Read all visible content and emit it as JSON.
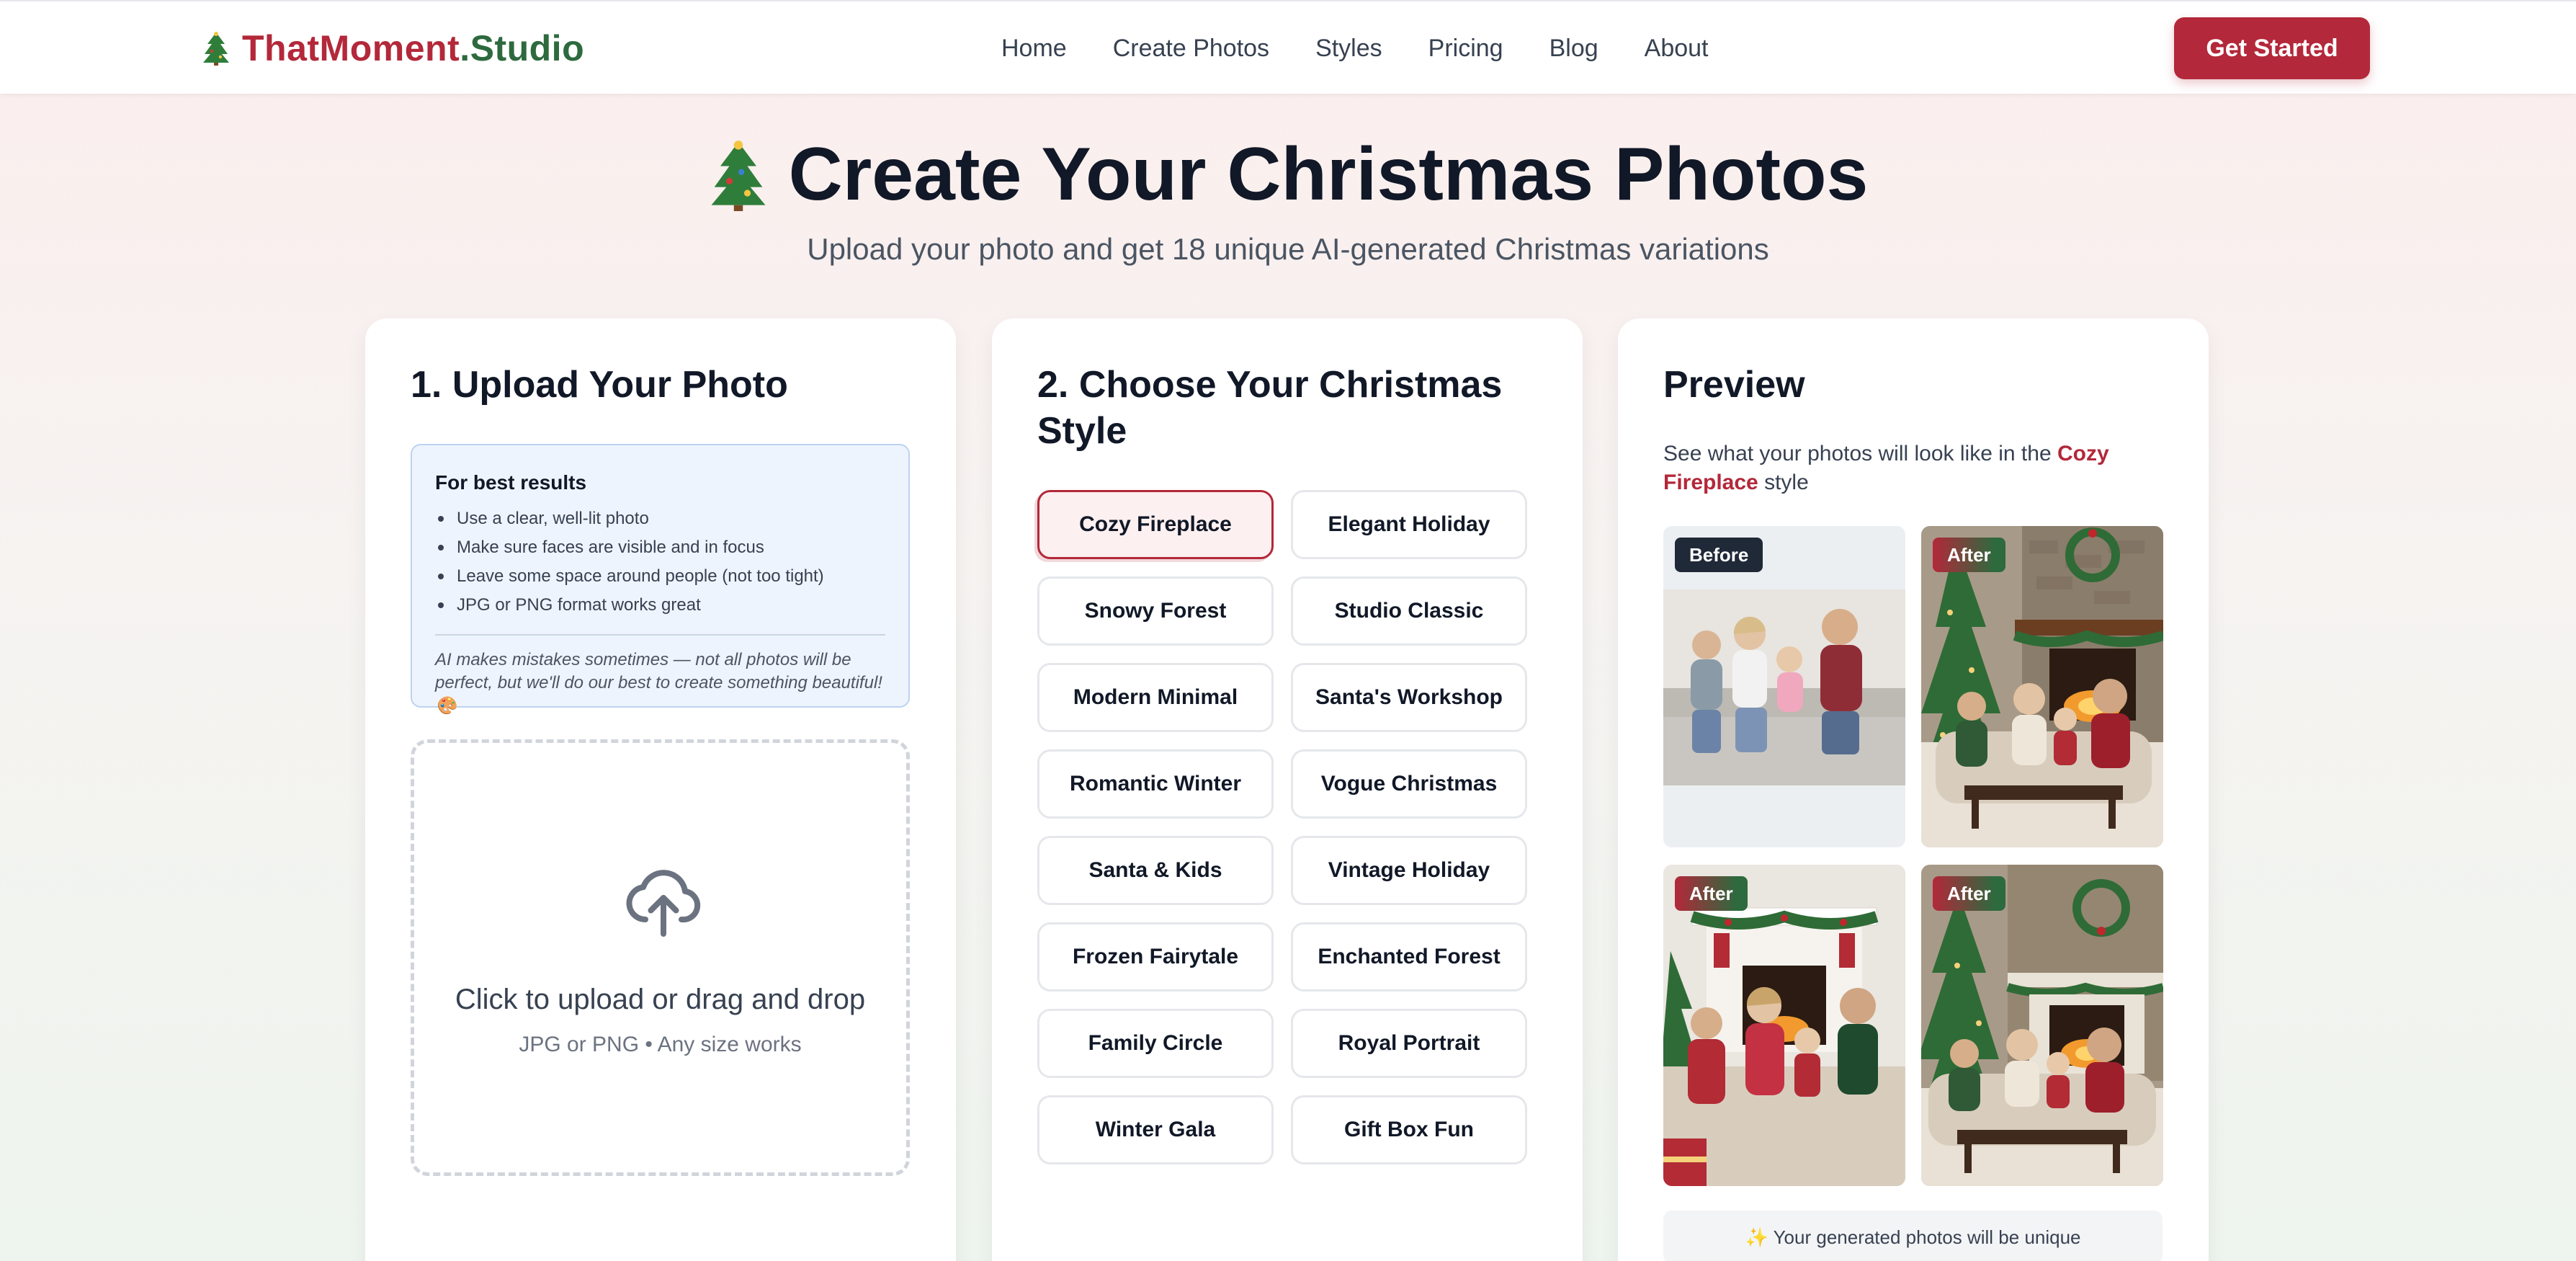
{
  "header": {
    "logo_part1": "ThatMoment",
    "logo_part2": ".Studio",
    "logo_icon": "christmas-tree-icon",
    "nav": [
      "Home",
      "Create Photos",
      "Styles",
      "Pricing",
      "Blog",
      "About"
    ],
    "cta_label": "Get Started"
  },
  "hero": {
    "title": "Create Your Christmas Photos",
    "subtitle": "Upload your photo and get 18 unique AI-generated Christmas variations"
  },
  "upload": {
    "title": "1. Upload Your Photo",
    "tips_title": "For best results",
    "tips": [
      "Use a clear, well-lit photo",
      "Make sure faces are visible and in focus",
      "Leave some space around people (not too tight)",
      "JPG or PNG format works great"
    ],
    "note": "AI makes mistakes sometimes — not all photos will be perfect, but we'll do our best to create something beautiful! 🎨",
    "drop_main": "Click to upload or drag and drop",
    "drop_sub": "JPG or PNG • Any size works"
  },
  "styles": {
    "title": "2. Choose Your Christmas Style",
    "selected": "Cozy Fireplace",
    "options": [
      "Cozy Fireplace",
      "Elegant Holiday",
      "Snowy Forest",
      "Studio Classic",
      "Modern Minimal",
      "Santa's Workshop",
      "Romantic Winter",
      "Vogue Christmas",
      "Santa & Kids",
      "Vintage Holiday",
      "Frozen Fairytale",
      "Enchanted Forest",
      "Family Circle",
      "Royal Portrait",
      "Winter Gala",
      "Gift Box Fun"
    ]
  },
  "preview": {
    "title": "Preview",
    "desc_prefix": "See what your photos will look like in the",
    "desc_style": "Cozy Fireplace",
    "desc_suffix": "style",
    "badge_before": "Before",
    "badge_after": "After",
    "footer": "✨ Your generated photos will be unique"
  },
  "colors": {
    "brand_red": "#b3283a",
    "brand_green": "#2d6a3e",
    "text_dark": "#111827"
  }
}
